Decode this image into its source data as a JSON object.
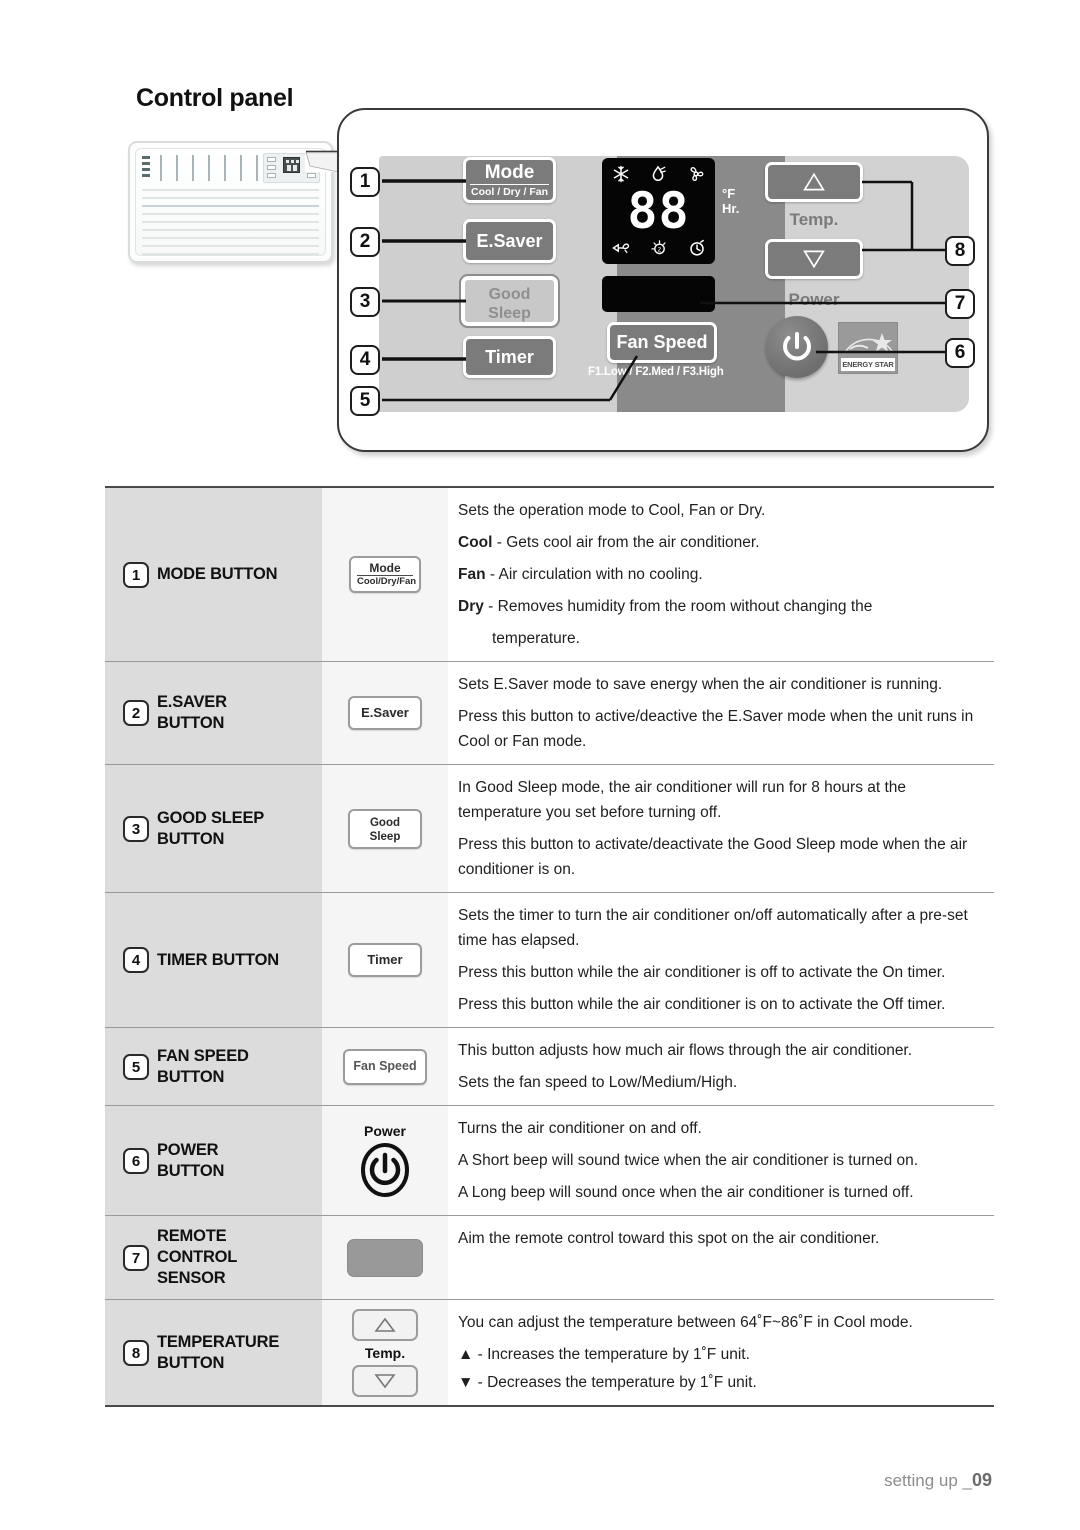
{
  "page": {
    "title": "Control panel",
    "footer_text": "setting up _",
    "footer_page": "09"
  },
  "diagram": {
    "callouts": [
      "1",
      "2",
      "3",
      "4",
      "5",
      "6",
      "7",
      "8"
    ],
    "buttons": {
      "mode_main": "Mode",
      "mode_sub": "Cool / Dry / Fan",
      "esaver": "E.Saver",
      "good_sleep_line1": "Good",
      "good_sleep_line2": "Sleep",
      "timer": "Timer",
      "fan_speed": "Fan Speed",
      "fan_speed_legend": "F1.Low / F2.Med / F3.High",
      "temp_label": "Temp.",
      "power_label": "Power"
    },
    "display": {
      "digits": "88",
      "unit_line1": "°F",
      "unit_line2": "Hr.",
      "icons_top": [
        "cool-snowflake-icon",
        "dry-droplet-icon",
        "fan-blade-icon"
      ],
      "icons_bottom": [
        "esaver-plug-icon",
        "good-sleep-moon-icon",
        "timer-clock-icon"
      ]
    },
    "energy_star_label": "ENERGY STAR",
    "colors": {
      "panel_left_bg": "#cfcfcf",
      "panel_mid_bg": "#8a8a8a",
      "panel_right_bg": "#d2d2d2",
      "button_face": "#7b7b7b",
      "lcd_bg": "#050505"
    }
  },
  "table": {
    "rows": [
      {
        "num": "1",
        "name": "MODE BUTTON",
        "icon": {
          "kind": "mode",
          "line1": "Mode",
          "line2": "Cool/Dry/Fan"
        },
        "desc": [
          {
            "text": "Sets the operation mode to Cool, Fan or Dry."
          },
          {
            "lead": "Cool",
            "text": " - Gets cool air from the air conditioner."
          },
          {
            "lead": "Fan",
            "text": " - Air circulation with no cooling."
          },
          {
            "lead": "Dry",
            "text": " - Removes humidity from the room without changing the"
          },
          {
            "text": "temperature.",
            "indent": true
          }
        ]
      },
      {
        "num": "2",
        "name": "E.SAVER\nBUTTON",
        "icon": {
          "kind": "plain",
          "line1": "E.Saver"
        },
        "desc": [
          {
            "text": "Sets E.Saver mode to save energy when the air conditioner is running."
          },
          {
            "text": " Press this button to active/deactive the E.Saver mode when the unit runs in Cool or Fan mode."
          }
        ]
      },
      {
        "num": "3",
        "name": "GOOD SLEEP\nBUTTON",
        "icon": {
          "kind": "two",
          "line1": "Good",
          "line2": "Sleep"
        },
        "desc": [
          {
            "text": "In Good Sleep mode, the air conditioner will run for 8 hours at the temperature you set before turning off."
          },
          {
            "text": "Press this button to activate/deactivate the Good Sleep mode when the air conditioner is on."
          }
        ]
      },
      {
        "num": "4",
        "name": "TIMER BUTTON",
        "icon": {
          "kind": "plain",
          "line1": "Timer"
        },
        "desc": [
          {
            "text": "Sets the timer to turn the air conditioner on/off automatically after a pre-set time has elapsed."
          },
          {
            "text": "Press this button while the air conditioner is off to activate the On timer."
          },
          {
            "text": "Press this button while the air conditioner is on to activate the Off timer."
          }
        ]
      },
      {
        "num": "5",
        "name": "FAN SPEED\nBUTTON",
        "icon": {
          "kind": "fan",
          "line1": "Fan Speed"
        },
        "desc": [
          {
            "text": "This button adjusts how much air flows through the air conditioner."
          },
          {
            "text": "Sets the fan speed to Low/Medium/High."
          }
        ]
      },
      {
        "num": "6",
        "name": "POWER\nBUTTON",
        "icon": {
          "kind": "power",
          "line1": "Power"
        },
        "desc": [
          {
            "text": "Turns the air conditioner on and off."
          },
          {
            "text": "A Short beep will sound twice when the air conditioner is turned on."
          },
          {
            "text": "A Long beep will sound once when the air conditioner is turned off."
          }
        ]
      },
      {
        "num": "7",
        "name": "REMOTE\nCONTROL\nSENSOR",
        "icon": {
          "kind": "sensor"
        },
        "desc": [
          {
            "text": "Aim the remote control toward this spot on the air conditioner."
          }
        ]
      },
      {
        "num": "8",
        "name": "TEMPERATURE\nBUTTON",
        "icon": {
          "kind": "temp",
          "line1": "Temp."
        },
        "desc": [
          {
            "text": "You can adjust the temperature between 64˚F~86˚F in Cool mode."
          },
          {
            "text": "▲ - Increases the temperature by 1˚F unit."
          },
          {
            "text": "▼ - Decreases the temperature by 1˚F unit."
          }
        ]
      }
    ]
  }
}
